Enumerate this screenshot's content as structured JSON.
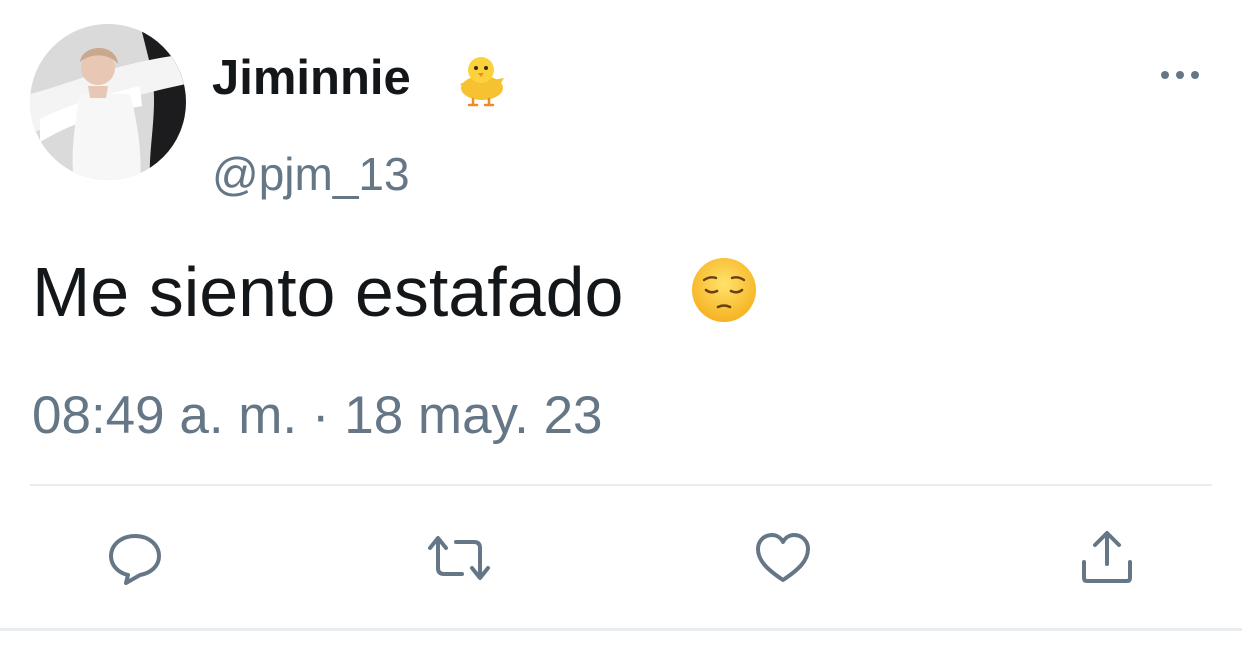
{
  "user": {
    "display_name": "Jiminnie",
    "name_emoji": "chick-icon",
    "handle": "@pjm_13"
  },
  "tweet": {
    "text": "Me siento estafado",
    "text_emoji": "pensive-face-icon",
    "timestamp": "08:49 a. m. · 18 may. 23"
  },
  "actions": {
    "reply": "reply-icon",
    "retweet": "retweet-icon",
    "like": "heart-icon",
    "share": "share-icon"
  },
  "colors": {
    "primary_text": "#14171a",
    "secondary_text": "#657786",
    "divider": "#e6ecf0"
  }
}
